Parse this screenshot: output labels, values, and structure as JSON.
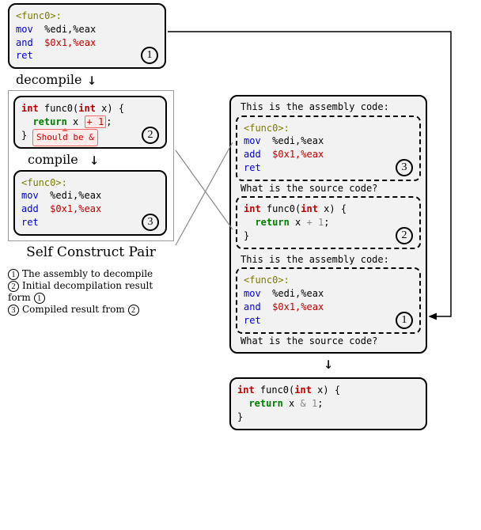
{
  "block1": {
    "line1_label": "<func0>:",
    "line2_op": "mov",
    "line2_args": "%edi,%eax",
    "line3_op": "and",
    "line3_args": "$0x1,%eax",
    "line4_op": "ret",
    "badge": "1"
  },
  "labels": {
    "decompile": "decompile",
    "compile": "compile",
    "self_construct": "Self Construct Pair"
  },
  "block2": {
    "sig_type1": "int",
    "sig_name": " func0(",
    "sig_type2": "int",
    "sig_rest": " x) {",
    "ret_kw": "return",
    "ret_rest": " x ",
    "ret_op": "+ 1",
    "ret_semi": ";",
    "close": "}",
    "callout": "Should be &",
    "badge": "2"
  },
  "block3": {
    "line1_label": "<func0>:",
    "line2_op": "mov",
    "line2_args": "%edi,%eax",
    "line3_op": "add",
    "line3_args": "$0x1,%eax",
    "line4_op": "ret",
    "badge": "3"
  },
  "right_header1": "This is the assembly code:",
  "right_block3": {
    "line1_label": "<func0>:",
    "line2_op": "mov",
    "line2_args": "%edi,%eax",
    "line3_op": "add",
    "line3_args": "$0x1,%eax",
    "line4_op": "ret",
    "badge": "3"
  },
  "right_q1": "What is the source code?",
  "right_block2": {
    "sig_type1": "int",
    "sig_name": " func0(",
    "sig_type2": "int",
    "sig_rest": " x) {",
    "ret_kw": "return",
    "ret_rest": " x ",
    "ret_op": "+ 1",
    "ret_semi": ";",
    "close": "}",
    "badge": "2"
  },
  "right_header2": "This is the assembly code:",
  "right_block1": {
    "line1_label": "<func0>:",
    "line2_op": "mov",
    "line2_args": "%edi,%eax",
    "line3_op": "and",
    "line3_args": "$0x1,%eax",
    "line4_op": "ret",
    "badge": "1"
  },
  "right_q2": "What is the source code?",
  "result": {
    "sig_type1": "int",
    "sig_name": " func0(",
    "sig_type2": "int",
    "sig_rest": " x) {",
    "ret_kw": "return",
    "ret_rest": " x ",
    "ret_op": "& 1",
    "ret_semi": ";",
    "close": "}"
  },
  "legend": {
    "l1_num": "1",
    "l1_text": "The assembly to decompile",
    "l2_num": "2",
    "l2_text_a": "Initial decompilation result form ",
    "l2_ref": "1",
    "l3_num": "3",
    "l3_text_a": "Compiled result from ",
    "l3_ref": "2"
  }
}
